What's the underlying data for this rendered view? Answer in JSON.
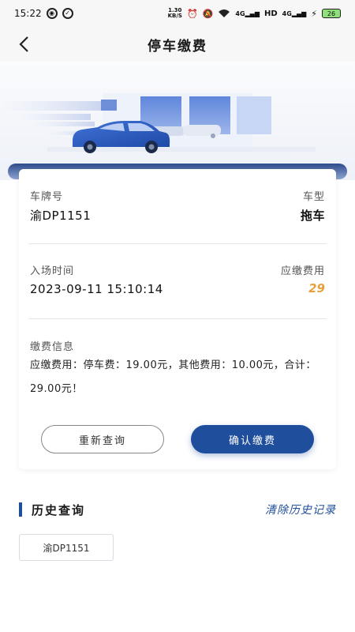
{
  "status_bar": {
    "time": "15:22",
    "net_speed_value": "1.30",
    "net_speed_unit": "KB/S",
    "signal_1": "4G",
    "hd": "HD",
    "signal_2": "4G",
    "battery": "26"
  },
  "nav": {
    "title": "停车缴费"
  },
  "card": {
    "plate_label": "车牌号",
    "plate_value": "渝DP1151",
    "type_label": "车型",
    "type_value": "拖车",
    "entry_label": "入场时间",
    "entry_value": "2023-09-11 15:10:14",
    "fee_label": "应缴费用",
    "fee_value": "29",
    "info_label": "缴费信息",
    "info_text": "应缴费用：停车费：19.00元，其他费用：10.00元，合计：29.00元！",
    "requery_label": "重新查询",
    "confirm_label": "确认缴费"
  },
  "history": {
    "title": "历史查询",
    "clear_label": "清除历史记录",
    "items": [
      "渝DP1151"
    ]
  },
  "colors": {
    "primary": "#1f4f9c",
    "fee": "#e8a13a"
  }
}
